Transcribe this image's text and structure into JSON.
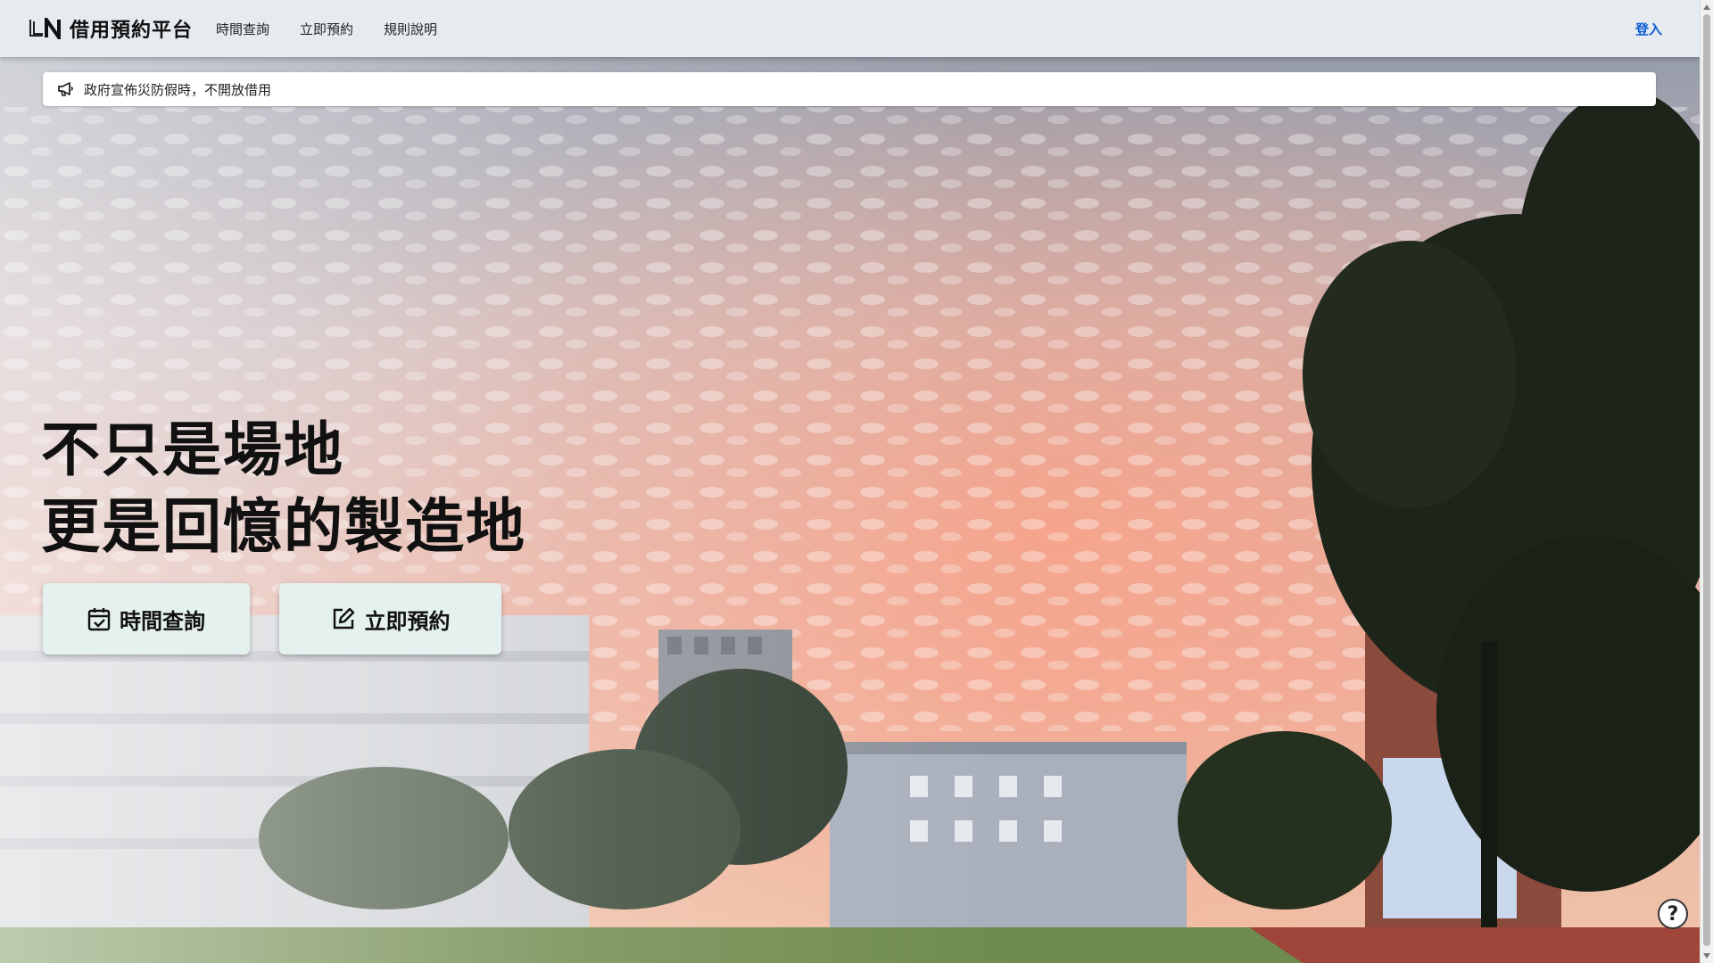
{
  "navbar": {
    "logo_icon": "ln-logo-icon",
    "brand_title": "借用預約平台",
    "links": [
      {
        "label": "時間查詢"
      },
      {
        "label": "立即預約"
      },
      {
        "label": "規則說明"
      }
    ],
    "login_label": "登入"
  },
  "announcement": {
    "icon": "megaphone-icon",
    "text": "政府宣佈災防假時，不開放借用"
  },
  "hero": {
    "line1": "不只是場地",
    "line2": "更是回憶的製造地",
    "buttons": [
      {
        "label": "時間查詢",
        "icon": "calendar-check-icon"
      },
      {
        "label": "立即預約",
        "icon": "edit-icon"
      }
    ]
  },
  "help": {
    "label": "?",
    "icon": "help-icon"
  },
  "colors": {
    "nav_bg": "#e6ebf0",
    "login_link": "#0b5cd6",
    "hero_button_bg": "#e4f1ee"
  }
}
